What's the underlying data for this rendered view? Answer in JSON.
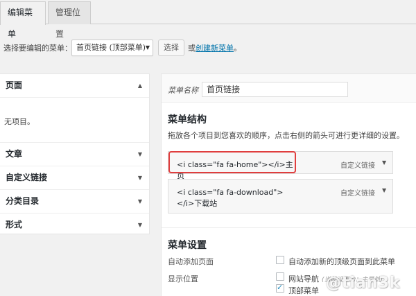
{
  "tabs": [
    {
      "label": "编辑菜单",
      "active": true
    },
    {
      "label": "管理位置",
      "active": false
    }
  ],
  "select_row": {
    "label": "选择要编辑的菜单：",
    "selected_menu": "首页链接 (顶部菜单)",
    "select_button": "选择",
    "or_text": "或",
    "create_link": "创建新菜单",
    "period": "。"
  },
  "left_panel": {
    "sections": [
      {
        "title": "页面",
        "arrow": "▲",
        "expanded": true
      },
      {
        "title": "文章",
        "arrow": "▼"
      },
      {
        "title": "自定义链接",
        "arrow": "▼"
      },
      {
        "title": "分类目录",
        "arrow": "▼"
      },
      {
        "title": "形式",
        "arrow": "▼"
      }
    ],
    "empty_text": "无项目。"
  },
  "right_panel": {
    "name_label": "菜单名称",
    "name_value": "首页链接",
    "structure_title": "菜单结构",
    "help_text": "拖放各个项目到您喜欢的顺序，点击右侧的箭头可进行更详细的设置。",
    "items": [
      {
        "title": "<i class=\"fa fa-home\"></i>主页",
        "type": "自定义链接",
        "arrow": "▼",
        "highlighted": true
      },
      {
        "title": "<i class=\"fa fa-download\"></i>下载站",
        "type": "自定义链接",
        "arrow": "▼"
      }
    ],
    "settings_title": "菜单设置",
    "auto_add_label": "自动添加页面",
    "auto_add_option": "自动添加新的顶级页面到此菜单",
    "display_label": "显示位置",
    "locations": [
      {
        "label": "网站导航",
        "note": "(当前设置为：主导航)",
        "checked": false
      },
      {
        "label": "顶部菜单",
        "checked": true
      }
    ]
  },
  "watermark": "@tian3k",
  "colors": {
    "link": "#0073aa",
    "highlight_border": "#e03e3e",
    "background": "#f1f1f1"
  }
}
